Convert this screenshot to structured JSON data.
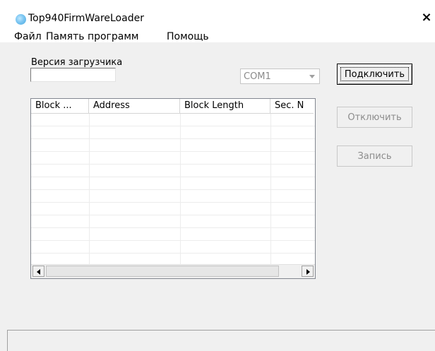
{
  "window": {
    "title": "Top940FirmWareLoader",
    "close_glyph": "×"
  },
  "menu": {
    "items": [
      "Файл",
      "Память программ",
      "Помощь"
    ]
  },
  "version": {
    "label": "Версия загрузчика",
    "value": ""
  },
  "port": {
    "selected": "COM1",
    "enabled": false
  },
  "buttons": {
    "connect": "Подключить",
    "disconnect": "Отключить",
    "write": "Запись"
  },
  "table": {
    "columns": [
      "Block ...",
      "Address",
      "Block Length",
      "Sec. N"
    ],
    "rows": []
  },
  "colors": {
    "background": "#f0f0f0",
    "disabled_text": "#8c8c8c",
    "grid_line": "#ececec"
  }
}
